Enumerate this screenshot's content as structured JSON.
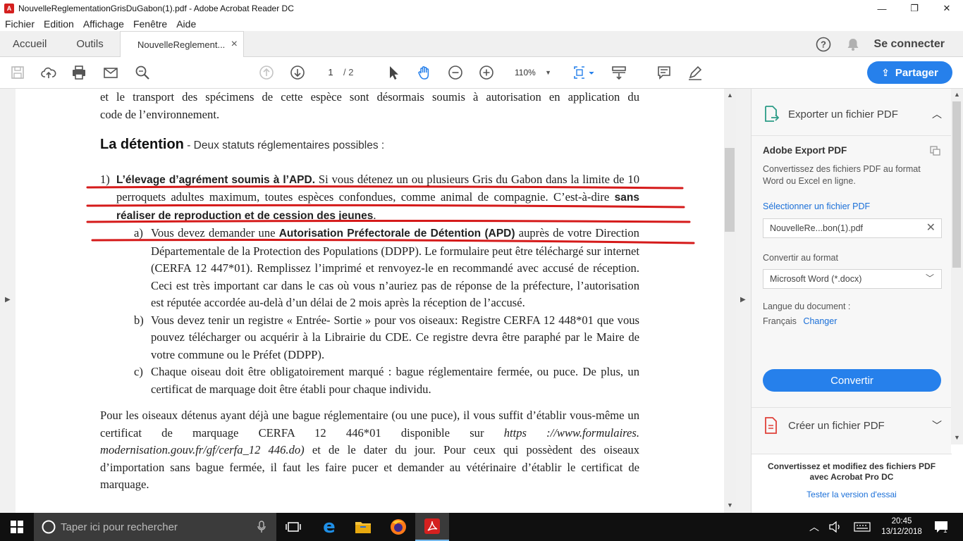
{
  "window": {
    "title": "NouvelleReglementationGrisDuGabon(1).pdf - Adobe Acrobat Reader DC",
    "minimize": "—",
    "maximize": "❐",
    "close": "✕"
  },
  "menu": [
    "Fichier",
    "Edition",
    "Affichage",
    "Fenêtre",
    "Aide"
  ],
  "tabs": {
    "home": "Accueil",
    "tools": "Outils",
    "document": "NouvelleReglement...",
    "doc_close": "×",
    "signin": "Se connecter"
  },
  "toolbar": {
    "page_current": "1",
    "page_total": "/ 2",
    "zoom": "110%",
    "share_label": "Partager"
  },
  "document": {
    "intro_line1": "et le transport des spécimens de cette espèce sont désormais soumis à autorisation en application du",
    "intro_line2": "code de l’environnement.",
    "heading": "La détention",
    "heading_sub": " - Deux statuts réglementaires possibles :",
    "item1_num": "1)",
    "item1_bold": "L’élevage d’agrément soumis à l’APD.",
    "item1_text": " Si vous détenez un ou plusieurs Gris du Gabon dans la limite de 10 perroquets adultes maximum, toutes espèces confondues, comme animal de compagnie. C’est-à-dire ",
    "item1_bold2": "sans réaliser de reproduction et de cession des jeunes",
    "item1_end": ".",
    "a_label": "a)",
    "a_text1": "Vous devez demander une ",
    "a_bold": "Autorisation Préfectorale de Détention (APD)",
    "a_text2": " auprès de votre Direction Départementale de la Protection des Populations (DDPP). Le formulaire peut être téléchargé sur internet (CERFA 12 447*01). Remplissez l’imprimé et renvoyez-le en recommandé avec accusé de réception. Ceci est très important car dans le cas où vous n’auriez pas de réponse de la préfecture, l’autorisation est réputée accordée au-delà d’un délai de 2 mois après la réception de l’accusé.",
    "b_label": "b)",
    "b_text": "Vous devez tenir un registre « Entrée- Sortie » pour vos oiseaux: Registre CERFA 12 448*01 que vous pouvez télécharger ou acquérir à la Librairie du CDE. Ce registre devra être paraphé par le Maire de votre commune ou le Préfet (DDPP).",
    "c_label": "c)",
    "c_text": "Chaque oiseau doit être obligatoirement marqué : bague réglementaire fermée, ou puce. De plus, un certificat de marquage doit être établi pour chaque individu.",
    "para_text1": "Pour les oiseaux détenus ayant déjà une bague réglementaire (ou une puce), il vous suffit d’établir vous-même un certificat de marquage CERFA 12 446*01 disponible sur ",
    "para_link": "https ://www.formulaires. modernisation.gouv.fr/gf/cerfa_12 446.do)",
    "para_text2": " et de le dater du jour. Pour ceux qui possèdent des oiseaux d’importation sans bague fermée, il faut les faire pucer et demander au vétérinaire d’établir le certificat de marquage."
  },
  "right_pane": {
    "export_title": "Exporter un fichier PDF",
    "service_title": "Adobe Export PDF",
    "service_desc": "Convertissez des fichiers PDF au format Word ou Excel en ligne.",
    "select_file": "Sélectionner un fichier PDF",
    "file_name": "NouvelleRe...bon(1).pdf",
    "convert_to_label": "Convertir au format",
    "format_value": "Microsoft Word (*.docx)",
    "lang_label": "Langue du document :",
    "lang_value": "Français",
    "lang_change": "Changer",
    "convert_button": "Convertir",
    "create_title": "Créer un fichier PDF",
    "promo_text": "Convertissez et modifiez des fichiers PDF avec Acrobat Pro DC",
    "promo_link": "Tester la version d'essai"
  },
  "taskbar": {
    "search_placeholder": "Taper ici pour rechercher",
    "time": "20:45",
    "date": "13/12/2018",
    "notif_count": "1"
  },
  "colors": {
    "accent": "#2680eb",
    "annotation_red": "#d51a1a",
    "taskbar": "#101010"
  }
}
